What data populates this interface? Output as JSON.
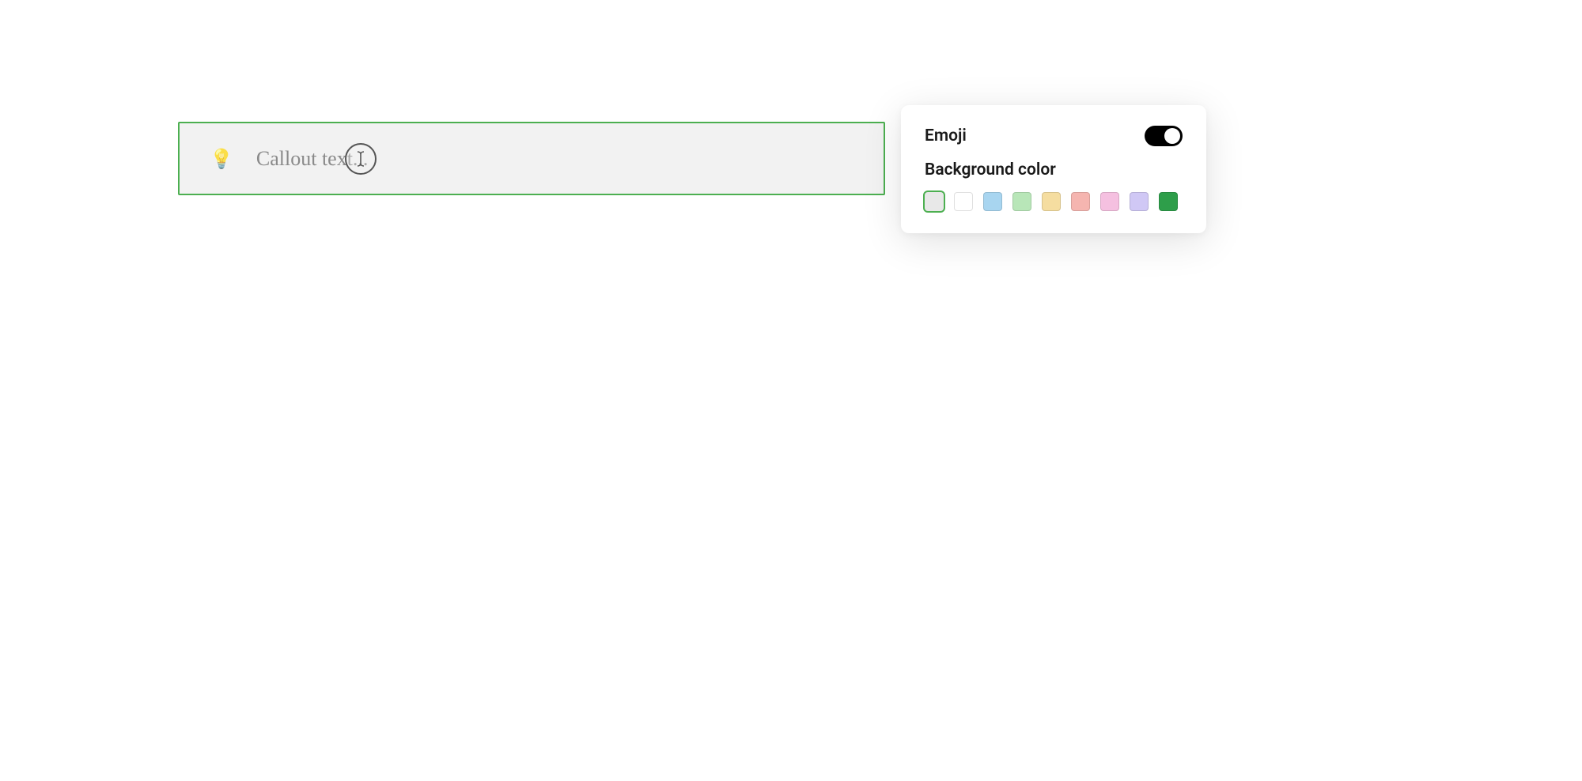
{
  "callout": {
    "emoji": "💡",
    "placeholder": "Callout text...",
    "value": ""
  },
  "panel": {
    "emoji_label": "Emoji",
    "emoji_enabled": true,
    "bg_label": "Background color",
    "colors": [
      {
        "hex": "#e8e8e8",
        "selected": true
      },
      {
        "hex": "#ffffff",
        "selected": false
      },
      {
        "hex": "#a8d5f0",
        "selected": false
      },
      {
        "hex": "#b8e6b8",
        "selected": false
      },
      {
        "hex": "#f5dda0",
        "selected": false
      },
      {
        "hex": "#f5b5b0",
        "selected": false
      },
      {
        "hex": "#f5c0e0",
        "selected": false
      },
      {
        "hex": "#d0c8f5",
        "selected": false
      },
      {
        "hex": "#2e9e4a",
        "selected": false
      }
    ]
  }
}
